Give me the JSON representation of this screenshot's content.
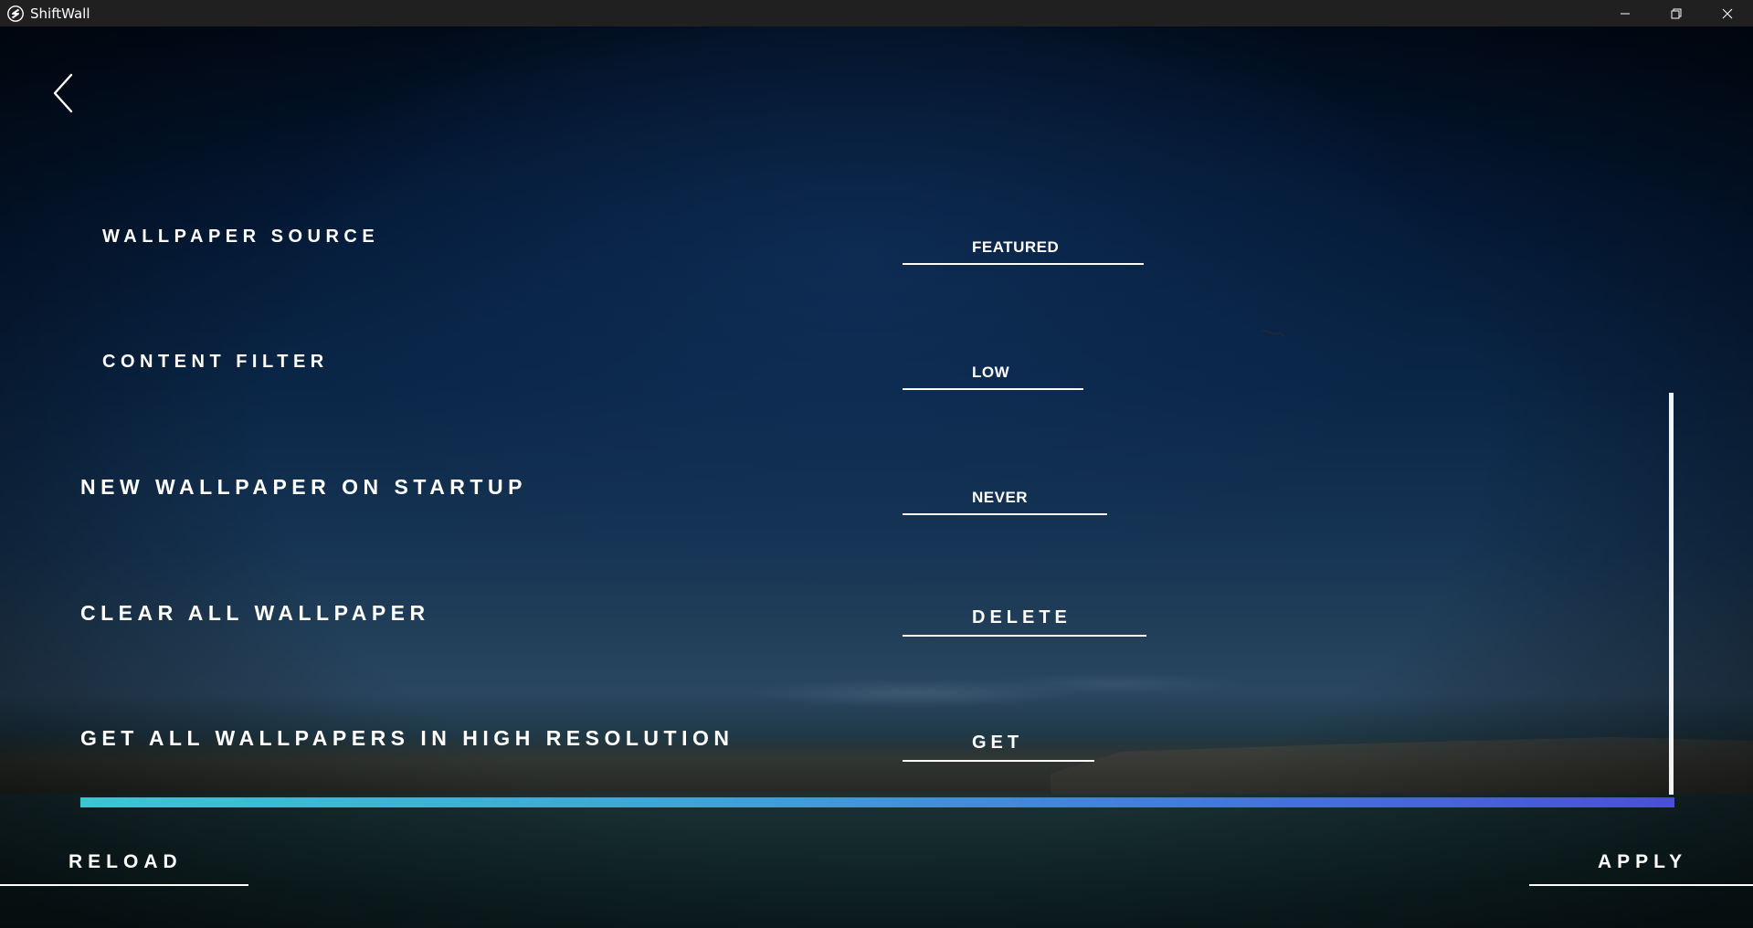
{
  "window": {
    "title": "ShiftWall",
    "icon": "shiftwall-logo-icon",
    "controls": [
      "minimize-icon",
      "restore-icon",
      "close-icon"
    ]
  },
  "nav": {
    "back_icon": "chevron-left-icon"
  },
  "settings": {
    "wallpaper_source": {
      "label": "WALLPAPER SOURCE",
      "value": "FEATURED"
    },
    "content_filter": {
      "label": "CONTENT FILTER",
      "value": "LOW"
    },
    "new_on_startup": {
      "label": "NEW WALLPAPER ON STARTUP",
      "value": "NEVER"
    },
    "clear_all": {
      "label": "CLEAR ALL WALLPAPER",
      "action": "DELETE"
    },
    "high_res": {
      "label": "GET ALL WALLPAPERS IN HIGH RESOLUTION",
      "action": "GET"
    }
  },
  "footer": {
    "reload_label": "RELOAD",
    "apply_label": "APPLY"
  },
  "colors": {
    "gradient_start": "#3bc6d2",
    "gradient_end": "#4a4fd6",
    "titlebar": "#202020",
    "text": "#ffffff"
  }
}
